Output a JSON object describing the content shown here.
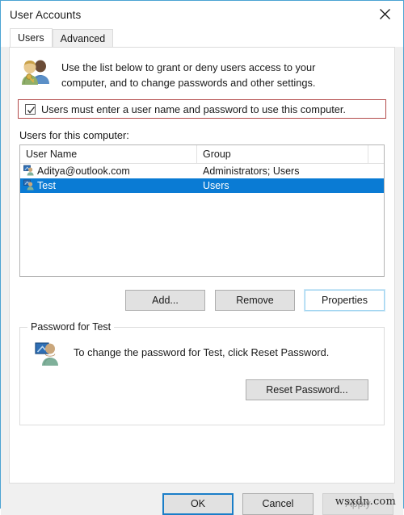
{
  "window": {
    "title": "User Accounts",
    "close_icon": "close-icon",
    "border_color": "#4ba3d3"
  },
  "tabs": [
    {
      "label": "Users",
      "selected": true
    },
    {
      "label": "Advanced",
      "selected": false
    }
  ],
  "intro": {
    "icon": "users-key-icon",
    "line1": "Use the list below to grant or deny users access to your",
    "line2": "computer, and to change passwords and other settings."
  },
  "require_password": {
    "label": "Users must enter a user name and password to use this computer.",
    "checked": true,
    "highlight_color": "#b34a4a",
    "check_color": "#333333"
  },
  "users_list": {
    "label": "Users for this computer:",
    "columns": [
      "User Name",
      "Group",
      ""
    ],
    "rows": [
      {
        "icon": "user-icon",
        "name": "Aditya@outlook.com",
        "group": "Administrators; Users",
        "selected": false
      },
      {
        "icon": "user-icon",
        "name": "Test",
        "group": "Users",
        "selected": true
      }
    ],
    "selection_color": "#0a7bd4"
  },
  "list_actions": {
    "add": "Add...",
    "remove": "Remove",
    "properties": "Properties",
    "properties_focused": true
  },
  "password_group": {
    "title": "Password for Test",
    "icon": "user-card-icon",
    "description": "To change the password for Test, click Reset Password.",
    "reset_button": "Reset Password..."
  },
  "footer": {
    "ok": "OK",
    "cancel": "Cancel",
    "apply": "Apply",
    "apply_disabled": true,
    "ok_is_default": true,
    "watermark": "wsxdn.com"
  }
}
